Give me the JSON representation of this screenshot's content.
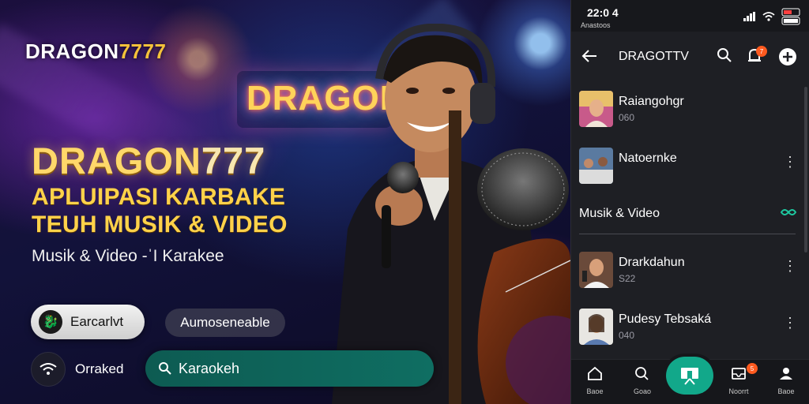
{
  "hero": {
    "logo_main": "DRAGON",
    "logo_num": "7777",
    "neon_sign": "DRAGON",
    "headline_main": "DRAGON",
    "headline_num": "777",
    "subtitle_line1": "APLUIPASI KARBAKE",
    "subtitle_line2": "TEUH MUSIK & VIDEO",
    "tagline": "Musik & Video -ˈI Karakee",
    "start_button": "Earcarlvt",
    "auto_button": "Aumoseneable",
    "trending_label": "Orraked",
    "search_value": "Karaokeh"
  },
  "status_bar": {
    "time": "22:0 4",
    "carrier": "Anastoos"
  },
  "app_bar": {
    "title": "DRAGOTTV",
    "notification_badge": "7"
  },
  "list_top": [
    {
      "title": "Raiangohgr",
      "subtitle": "060"
    },
    {
      "title": "Natoernke",
      "subtitle": ""
    }
  ],
  "section": {
    "label": "Musik & Video"
  },
  "list_bottom": [
    {
      "title": "Drarkdahun",
      "subtitle": "S22"
    },
    {
      "title": "Pudesy Tebsaká",
      "subtitle": "040"
    }
  ],
  "bottom_nav": {
    "items": [
      {
        "label": "Baoe",
        "icon": "home-icon"
      },
      {
        "label": "Goao",
        "icon": "search-icon"
      },
      {
        "label": "",
        "icon": "karaoke-screen-icon"
      },
      {
        "label": "Noorrt",
        "icon": "inbox-icon",
        "badge": "5"
      },
      {
        "label": "Baoe",
        "icon": "profile-icon"
      }
    ]
  },
  "colors": {
    "accent_gold": "#ffd24a",
    "accent_teal": "#12a88a",
    "badge_orange": "#ff5a1f",
    "panel_bg": "#1e1f24"
  }
}
